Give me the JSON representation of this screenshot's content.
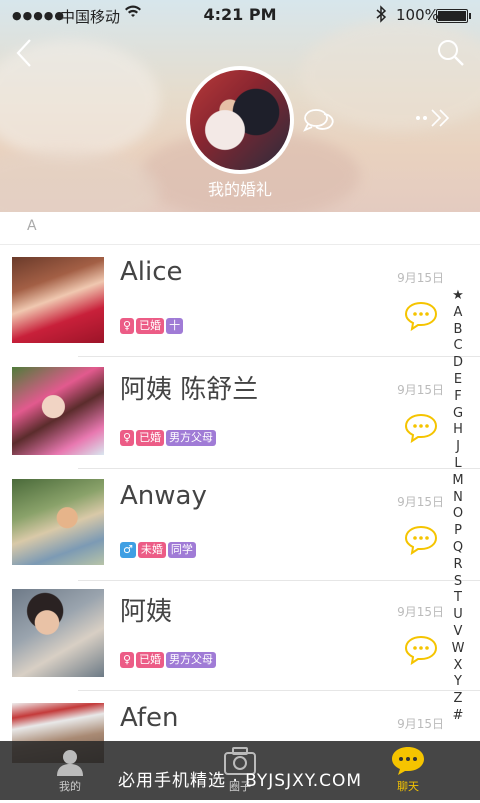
{
  "status_bar": {
    "carrier": "中国移动",
    "time": "4:21 PM",
    "battery": "100%"
  },
  "header": {
    "title": "我的婚礼"
  },
  "section": {
    "letter": "A"
  },
  "contacts": [
    {
      "name": "Alice",
      "date": "9月15日",
      "tags": [
        "♀",
        "已婚",
        "十"
      ]
    },
    {
      "name": "阿姨 陈舒兰",
      "date": "9月15日",
      "tags": [
        "♀",
        "已婚",
        "男方父母"
      ]
    },
    {
      "name": "Anway",
      "date": "9月15日",
      "tags": [
        "♂",
        "未婚",
        "同学"
      ]
    },
    {
      "name": "阿姨",
      "date": "9月15日",
      "tags": [
        "♀",
        "已婚",
        "男方父母"
      ]
    },
    {
      "name": "Afen",
      "date": "9月15日"
    }
  ],
  "index_letters": [
    "★",
    "A",
    "B",
    "C",
    "D",
    "E",
    "F",
    "G",
    "H",
    "J",
    "L",
    "M",
    "N",
    "O",
    "P",
    "Q",
    "R",
    "S",
    "T",
    "U",
    "V",
    "W",
    "X",
    "Y",
    "Z",
    "#"
  ],
  "tabbar": {
    "tabs": [
      {
        "label": "我的",
        "icon": "profile-icon"
      },
      {
        "label": "圈子",
        "icon": "camera-icon"
      },
      {
        "label": "聊天",
        "icon": "chat-icon",
        "active": true
      }
    ]
  },
  "watermark": "必用手机精选 · BYJSJXY.COM",
  "colors": {
    "accent": "#f5c400",
    "female": "#ec5c86",
    "male": "#3f9fe3",
    "purple": "#a07bd6"
  }
}
